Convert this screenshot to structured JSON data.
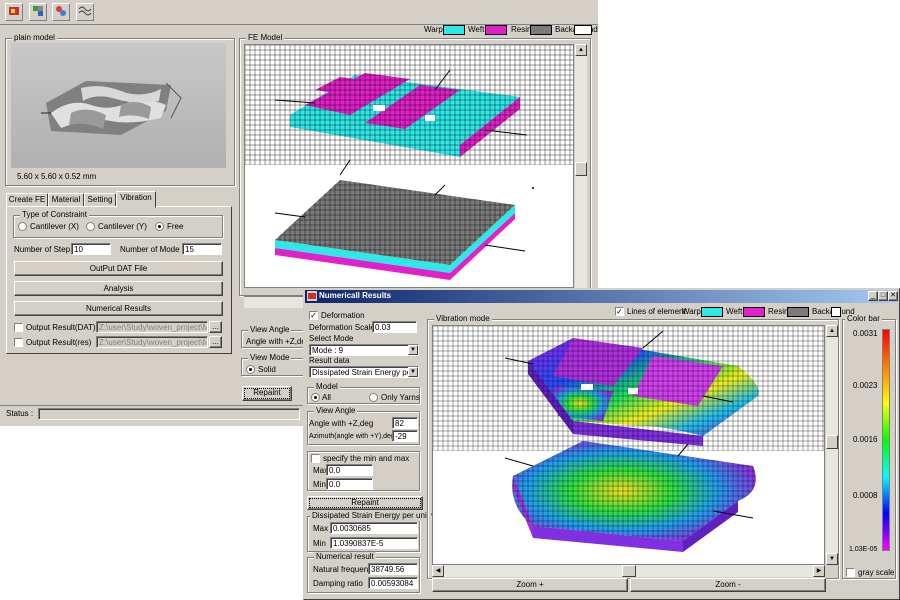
{
  "toolbar": {
    "icons": [
      "new-model-icon",
      "mesh-icon",
      "material-icon",
      "wave-icon"
    ]
  },
  "colors": {
    "warp": "#2ee8e8",
    "weft": "#e020c8",
    "resin": "#7a7a7a",
    "background": "#ffffff"
  },
  "legend": {
    "warp": "Warp",
    "weft": "Weft",
    "resin": "Resin",
    "background": "Backaround"
  },
  "main": {
    "plain_model_label": "plain model",
    "fe_model_label": "FE Model",
    "dimensions": "5.60 x 5.60 x 0.52 mm",
    "tabs": [
      "Create FE",
      "Material",
      "Setting",
      "Vibration"
    ],
    "active_tab": "Vibration",
    "constraint": {
      "label": "Type of Constraint",
      "options": [
        "Cantilever (X)",
        "Cantilever (Y)",
        "Free"
      ],
      "selected": "Free"
    },
    "number_of_step_label": "Number of Step :",
    "number_of_step": "10",
    "number_of_mode_label": "Number of Mode :",
    "number_of_mode": "15",
    "buttons": {
      "output_dat": "OutPut DAT File",
      "analysis": "Analysis",
      "numerical_results": "Numerical Results"
    },
    "output_dat": {
      "label": "Output Result(DAT)",
      "path": "Z:\\user\\Study\\woven_project\\Me"
    },
    "output_res": {
      "label": "Output Result(res)",
      "path": "Z:\\user\\Study\\woven_project\\Me"
    },
    "browse": "...",
    "view_angle_label": "View Angle",
    "angle_with_z": "Angle with +Z,deg",
    "view_mode_label": "View Mode",
    "solid": "Solid",
    "repaint": "Repaint",
    "status_label": "Status :"
  },
  "results": {
    "title": "Numericall Results",
    "deformation_label": "Deformation",
    "deformation_scale_label": "Deformation Scale",
    "deformation_scale": "0.03",
    "select_mode_label": "Select Mode",
    "select_mode": "Mode : 9",
    "result_data_label": "Result data",
    "result_data": "Dissipated Strain Energy per un",
    "model_label": "Model",
    "model_options": [
      "All",
      "Only Yarns"
    ],
    "model_selected": "All",
    "view_angle_label": "View Angle",
    "angle_z_label": "Angle with +Z,deg",
    "angle_z": "82",
    "azimuth_label": "Azimuth(angle with +Y),deg",
    "azimuth": "-29",
    "specify_label": "specify the min and max",
    "max_label": "Max",
    "max_value": "0.0",
    "min_label": "Min",
    "min_value": "0.0",
    "repaint": "Repaint",
    "dissipated_label": "Dissipated Strain Energy per unit vo",
    "dmax_label": "Max",
    "dmax": "0.0030685",
    "dmin_label": "Min",
    "dmin": "1.0390837E-5",
    "numerical_label": "Numerical result",
    "freq_label": "Natural frequency",
    "freq": "38749.56",
    "damping_label": "Damping ratio",
    "damping": "0.00593084",
    "lines_label": "Lines of element",
    "vibration_mode_label": "Vibration mode",
    "zoom_in": "Zoom +",
    "zoom_out": "Zoom -",
    "color_bar_label": "Color bar",
    "color_ticks": [
      "0.0031",
      "0.0023",
      "0.0016",
      "0.0008",
      "1.03E-05"
    ],
    "gray_scale": "gray scale"
  }
}
